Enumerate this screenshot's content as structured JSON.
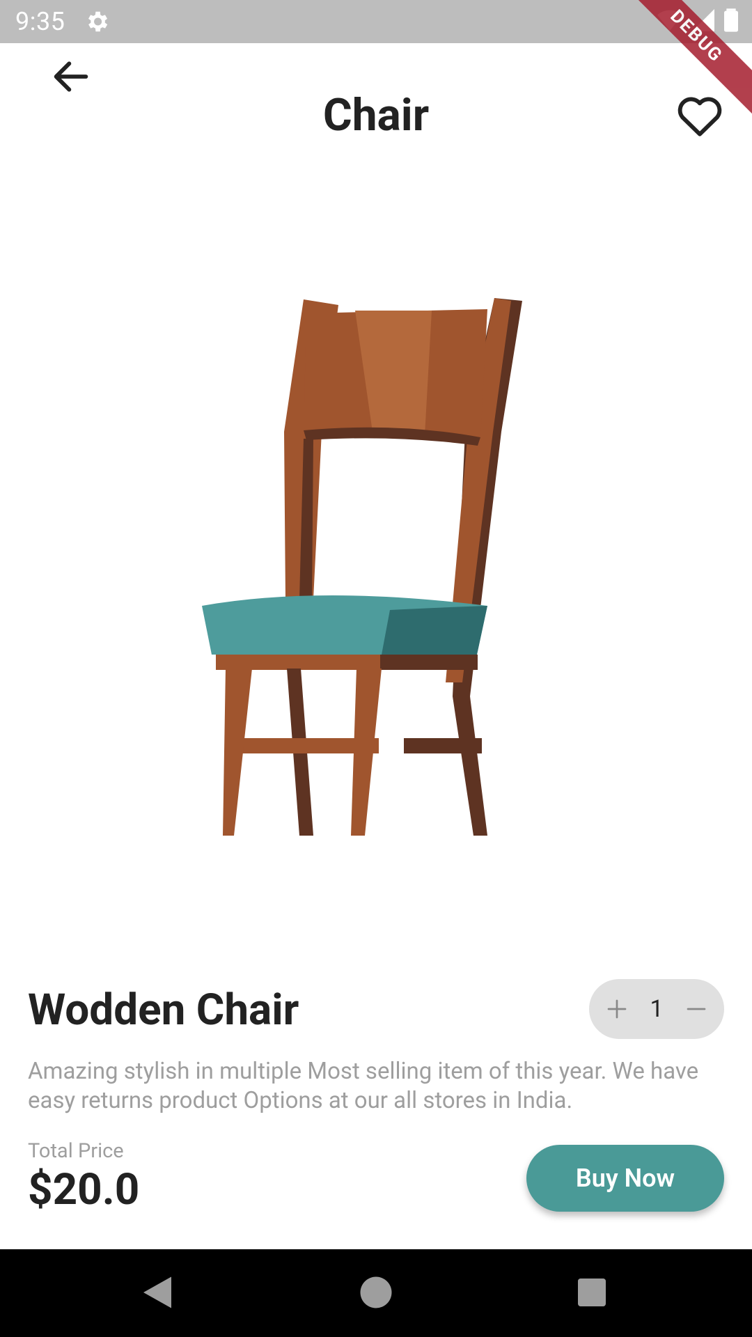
{
  "status_bar": {
    "time": "9:35"
  },
  "app_bar": {
    "title": "Chair"
  },
  "debug_banner": {
    "text": "DEBUG"
  },
  "product": {
    "name": "Wodden Chair",
    "description": "Amazing stylish in multiple Most selling item of this year. We have easy returns product Options at our all stores in India.",
    "quantity": "1"
  },
  "pricing": {
    "label": "Total Price",
    "amount": "$20.0"
  },
  "actions": {
    "buy_label": "Buy Now"
  },
  "colors": {
    "accent": "#4a9a97",
    "chair_wood": "#a0552e",
    "chair_dark": "#5e3322",
    "seat_teal": "#4e9c9c"
  },
  "icons": {
    "back": "arrow-left-icon",
    "favorite": "heart-outline-icon",
    "plus": "plus-icon",
    "minus": "minus-icon"
  }
}
